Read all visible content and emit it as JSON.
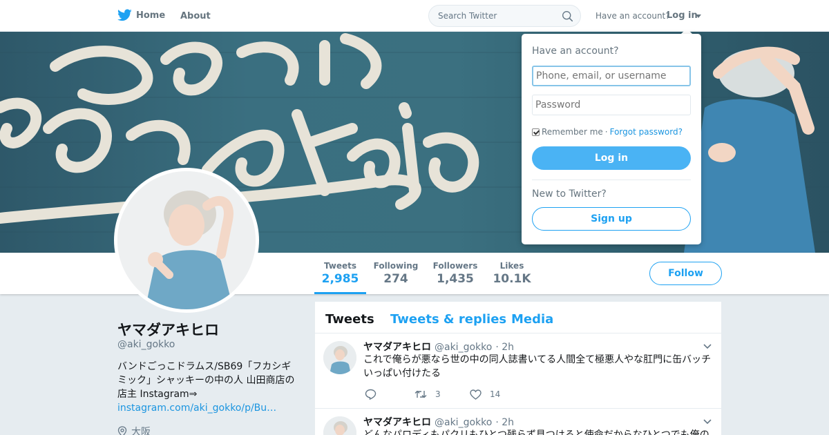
{
  "nav": {
    "home_label": "Home",
    "about_label": "About",
    "search_placeholder": "Search Twitter",
    "have_account": "Have an account?",
    "login_label": "Log in"
  },
  "colors": {
    "twitter_blue": "#1da1f2",
    "link_blue": "#1b95e0",
    "login_button": "#4ab3f4",
    "text_dark": "#14171a",
    "text_gray": "#657786"
  },
  "stats": [
    {
      "label": "Tweets",
      "value": "2,985",
      "active": true
    },
    {
      "label": "Following",
      "value": "274",
      "active": false
    },
    {
      "label": "Followers",
      "value": "1,435",
      "active": false
    },
    {
      "label": "Likes",
      "value": "10.1K",
      "active": false
    }
  ],
  "follow_label": "Follow",
  "profile": {
    "name": "ヤマダアキヒロ",
    "handle": "@aki_gokko",
    "bio": "バンドごっこドラムス/SB69「フカシギミック」シャッキーの中の人 山田商店の店主 Instagram⇒",
    "bio_link": "instagram.com/aki_gokko/p/Bu…",
    "location": "大阪"
  },
  "timeline": {
    "tabs": [
      {
        "label": "Tweets",
        "active": true
      },
      {
        "label": "Tweets & replies",
        "active": false
      },
      {
        "label": "Media",
        "active": false
      }
    ],
    "tweets": [
      {
        "name": "ヤマダアキヒロ",
        "handle": "@aki_gokko",
        "time": "· 2h",
        "text": "これで俺らが悪なら世の中の同人誌書いてる人間全て極悪人やな肛門に缶バッチいっぱい付けたる",
        "retweets": "3",
        "likes": "14"
      },
      {
        "name": "ヤマダアキヒロ",
        "handle": "@aki_gokko",
        "time": "· 2h",
        "text": "どんなパロディもパクリもひとつ残らず見つけると使命だからなひとつでも俺の"
      }
    ]
  },
  "login_dropdown": {
    "title": "Have an account?",
    "username_placeholder": "Phone, email, or username",
    "password_placeholder": "Password",
    "remember_me": "Remember me",
    "separator": "·",
    "forgot_password": "Forgot password?",
    "login_button": "Log in",
    "new_to_twitter": "New to Twitter?",
    "signup_button": "Sign up"
  }
}
